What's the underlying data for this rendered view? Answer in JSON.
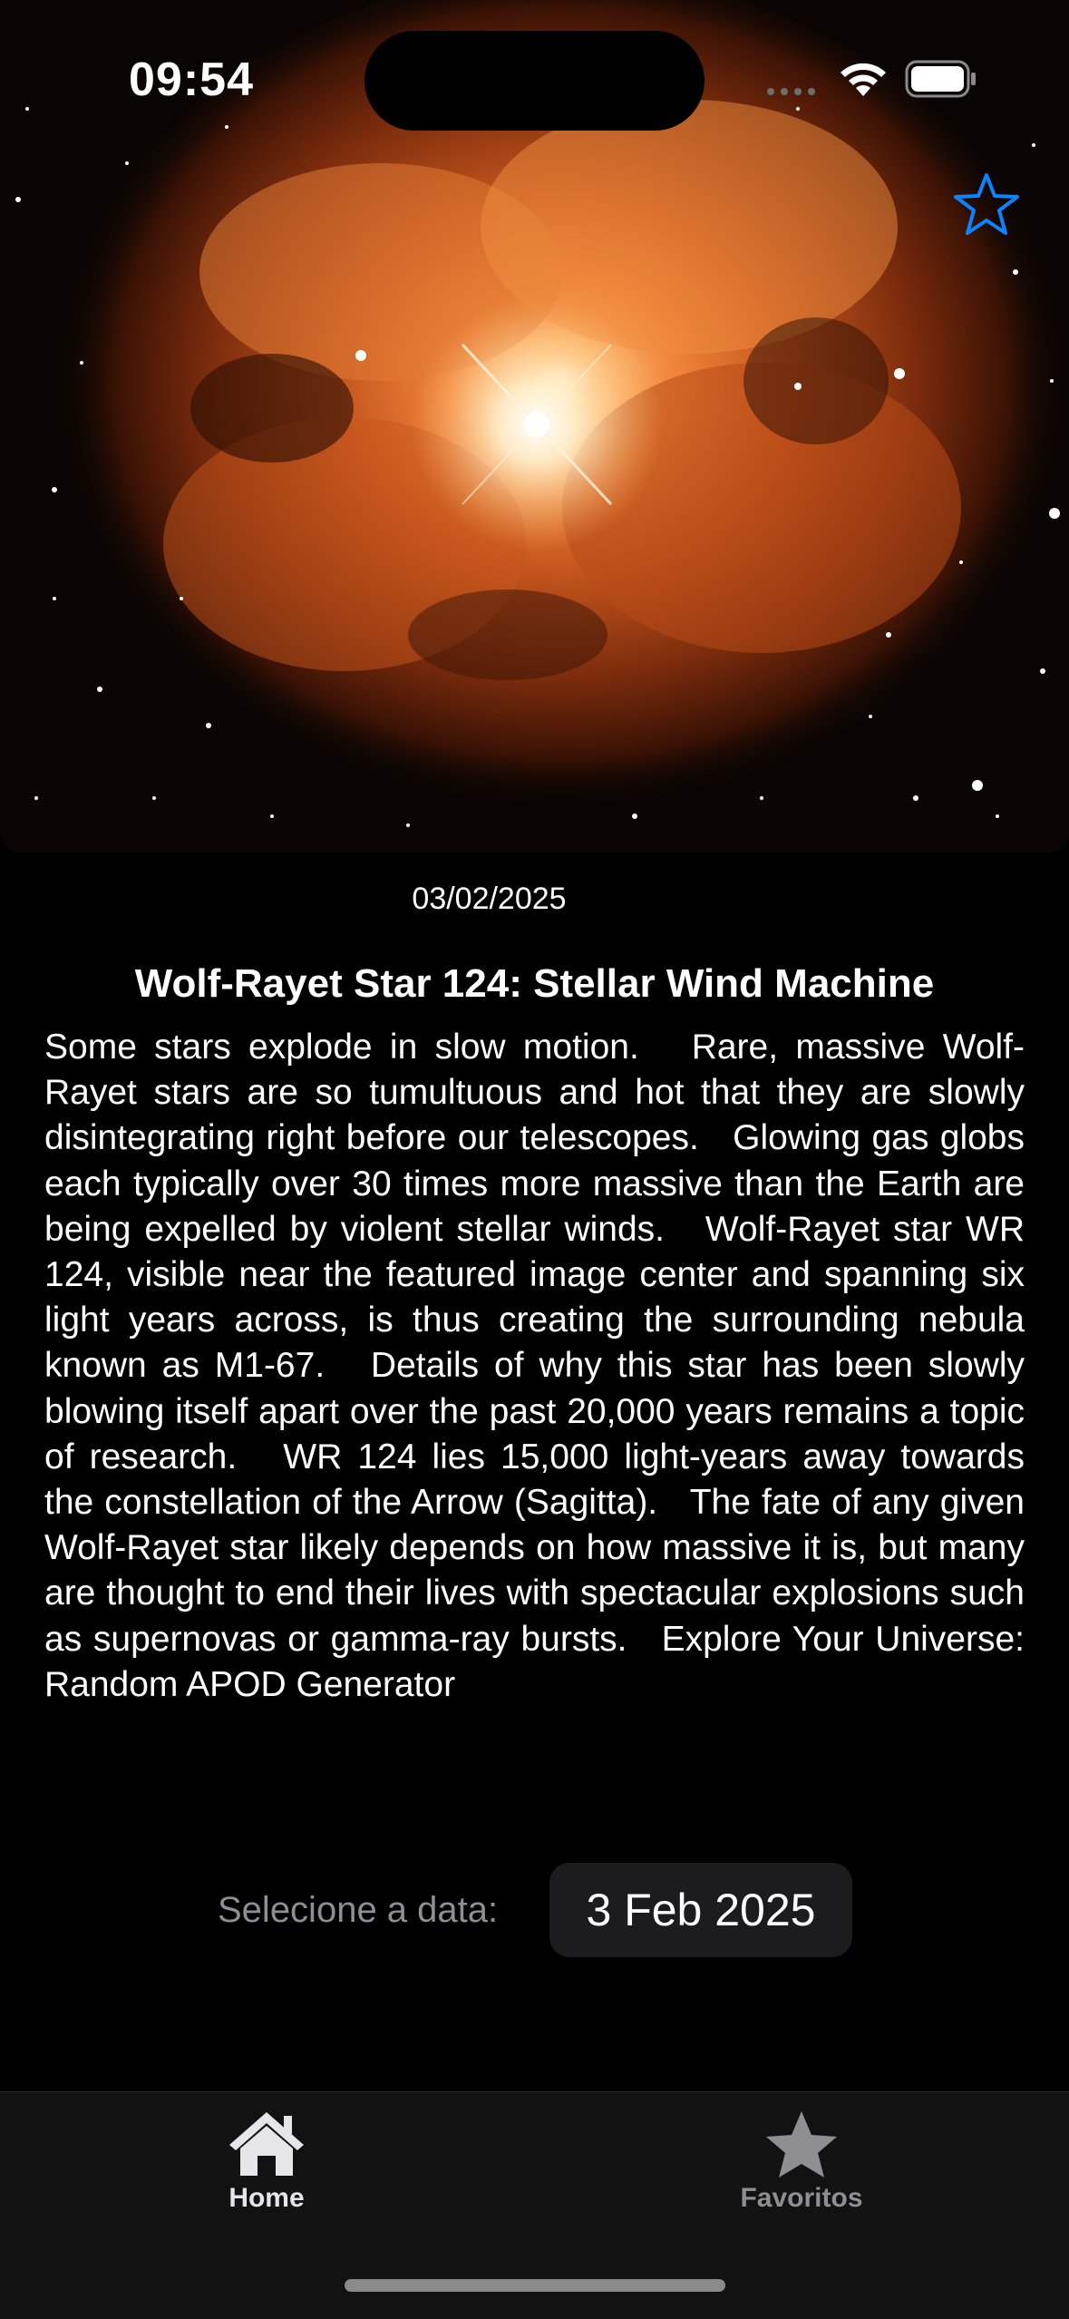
{
  "status_bar": {
    "time": "09:54"
  },
  "apod": {
    "image_subject": "Wolf-Rayet star WR 124 nebula",
    "date": "03/02/2025",
    "title": "Wolf-Rayet Star 124: Stellar Wind Machine",
    "explanation": "Some stars explode in slow motion.   Rare, massive Wolf-Rayet stars are so tumultuous and hot that they are slowly disintegrating right before our telescopes.   Glowing gas globs each typically over 30 times more massive than the Earth are being expelled by violent stellar winds.   Wolf-Rayet star WR 124, visible near the featured image center and spanning six light years across, is thus creating the surrounding nebula known as M1-67.   Details of why this star has been slowly blowing itself apart over the past 20,000 years remains a topic of research.   WR 124 lies 15,000 light-years away towards the constellation of the Arrow (Sagitta).   The fate of any given Wolf-Rayet star likely depends on how massive it is, but many are thought to end their lives with spectacular explosions such as supernovas or gamma-ray bursts.   Explore Your Universe: Random APOD Generator",
    "favorite_icon": "star-outline-icon"
  },
  "date_picker": {
    "label": "Selecione a data:",
    "value": "3 Feb 2025"
  },
  "tab_bar": {
    "tabs": [
      {
        "label": "Home",
        "icon": "house-fill-icon",
        "selected": true
      },
      {
        "label": "Favoritos",
        "icon": "star-fill-icon",
        "selected": false
      }
    ]
  },
  "colors": {
    "accent": "#0a84ff",
    "background": "#000000",
    "tab_bar_background": "#121212",
    "picker_background": "#1c1c1e",
    "secondary_text": "#8e8e93"
  }
}
